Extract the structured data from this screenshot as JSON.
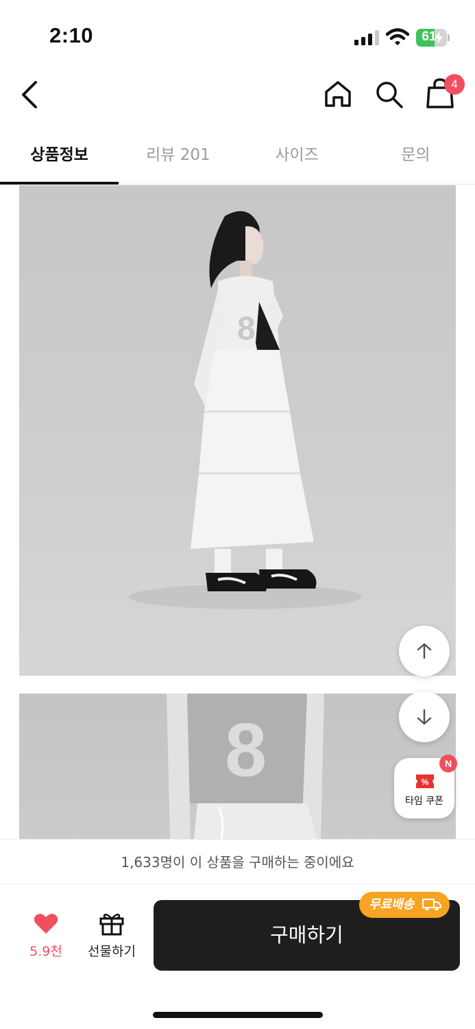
{
  "status_bar": {
    "time": "2:10",
    "battery_level": "61",
    "battery_fraction": 0.61,
    "battery_color": "#3ec25a",
    "icons": [
      "signal-icon",
      "wifi-icon",
      "battery-icon"
    ]
  },
  "nav": {
    "icons": [
      "back-icon",
      "home-icon",
      "search-icon",
      "cart-icon"
    ],
    "cart_count": "4"
  },
  "tabs": [
    {
      "label": "상품정보",
      "active": true
    },
    {
      "label": "리뷰 201",
      "active": false
    },
    {
      "label": "사이즈",
      "active": false
    },
    {
      "label": "문의",
      "active": false
    }
  ],
  "floating": {
    "scroll_up_icon": "arrow-up-icon",
    "scroll_down_icon": "arrow-down-icon",
    "coupon_label": "타임 쿠폰",
    "coupon_badge": "N",
    "coupon_icon_symbol": "%"
  },
  "bottom": {
    "buyers_text": "1,633명이 이 상품을 구매하는 중이에요",
    "like_count": "5.9천",
    "gift_label": "선물하기",
    "buy_label": "구매하기",
    "shipping_badge": "무료배송"
  },
  "colors": {
    "accent_red": "#f0505e",
    "buy_button": "#1e1e1e",
    "shipping_orange": "#f7a423"
  }
}
